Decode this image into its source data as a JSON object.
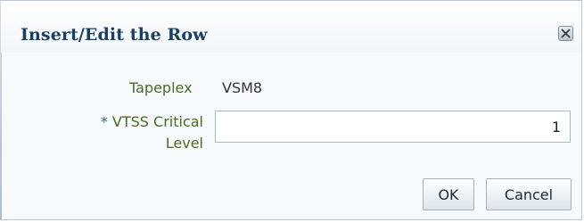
{
  "dialog": {
    "title": "Insert/Edit the Row",
    "close_icon": "close-icon"
  },
  "form": {
    "tapeplex_label": "Tapeplex",
    "tapeplex_value": "VSM8",
    "required_marker": "*",
    "vtss_label_line1": "VTSS Critical",
    "vtss_label_line2": "Level",
    "vtss_value": "1"
  },
  "buttons": {
    "ok": "OK",
    "cancel": "Cancel"
  }
}
